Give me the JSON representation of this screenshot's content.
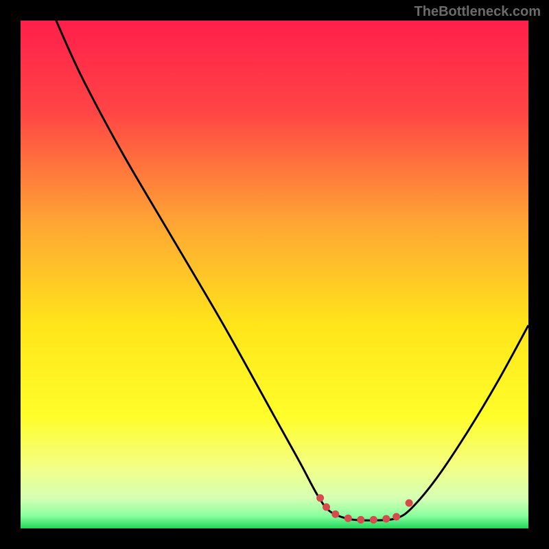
{
  "watermark": "TheBottleneck.com",
  "chart_data": {
    "type": "line",
    "title": "",
    "xlabel": "",
    "ylabel": "",
    "xlim": [
      0,
      100
    ],
    "ylim": [
      0,
      100
    ],
    "background_gradient": {
      "stops": [
        {
          "offset": 0.0,
          "color": "#ff1f4b"
        },
        {
          "offset": 0.18,
          "color": "#ff4545"
        },
        {
          "offset": 0.4,
          "color": "#ffa634"
        },
        {
          "offset": 0.6,
          "color": "#ffe51a"
        },
        {
          "offset": 0.78,
          "color": "#fffd2a"
        },
        {
          "offset": 0.88,
          "color": "#f3ff86"
        },
        {
          "offset": 0.94,
          "color": "#d6ffb4"
        },
        {
          "offset": 0.975,
          "color": "#8bff9e"
        },
        {
          "offset": 1.0,
          "color": "#1fd65b"
        }
      ]
    },
    "series": [
      {
        "name": "bottleneck-curve",
        "x": [
          7.0,
          12.0,
          20.0,
          30.0,
          40.0,
          50.0,
          55.0,
          58.5,
          61.0,
          65.0,
          70.0,
          74.0,
          77.0,
          82.0,
          88.0,
          94.0,
          100.0
        ],
        "y": [
          100.0,
          89.0,
          74.0,
          57.0,
          40.0,
          22.0,
          13.0,
          6.5,
          3.3,
          1.8,
          1.6,
          2.0,
          4.0,
          10.0,
          19.0,
          29.0,
          40.0
        ],
        "color": "#000000"
      }
    ],
    "markers": [
      {
        "x": 59.0,
        "y": 6.0,
        "color": "#d64b4b"
      },
      {
        "x": 60.2,
        "y": 4.2,
        "color": "#d64b4b"
      },
      {
        "x": 62.0,
        "y": 2.8,
        "color": "#d64b4b"
      },
      {
        "x": 64.5,
        "y": 2.0,
        "color": "#d64b4b"
      },
      {
        "x": 67.0,
        "y": 1.7,
        "color": "#d64b4b"
      },
      {
        "x": 69.5,
        "y": 1.7,
        "color": "#d64b4b"
      },
      {
        "x": 72.0,
        "y": 1.9,
        "color": "#d64b4b"
      },
      {
        "x": 74.0,
        "y": 2.3,
        "color": "#d64b4b"
      },
      {
        "x": 76.5,
        "y": 5.0,
        "color": "#d64b4b"
      }
    ]
  }
}
